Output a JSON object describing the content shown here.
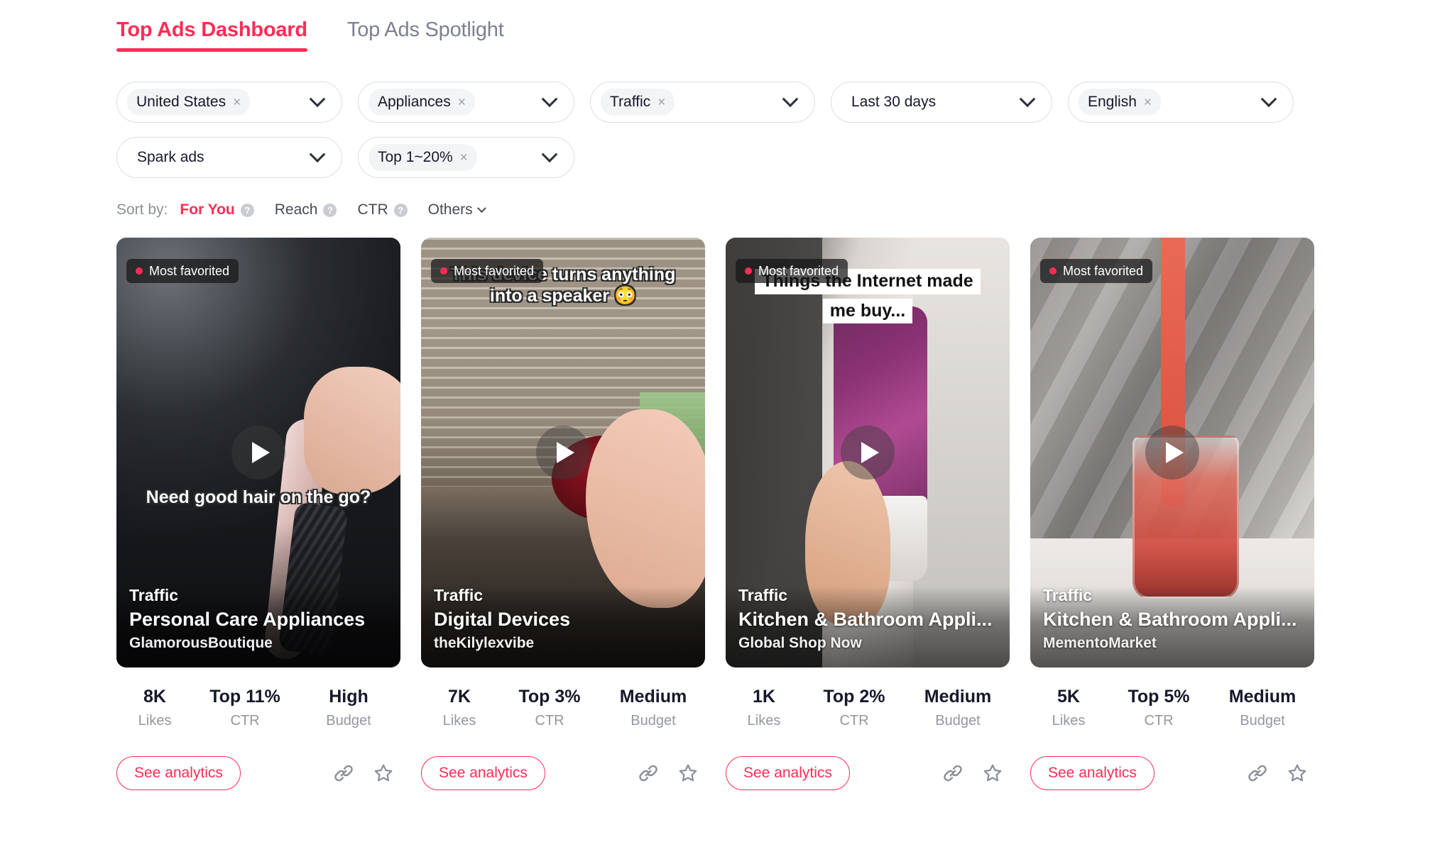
{
  "tabs": [
    {
      "label": "Top Ads Dashboard",
      "active": true
    },
    {
      "label": "Top Ads Spotlight",
      "active": false
    }
  ],
  "filters": [
    {
      "name": "region",
      "chip": "United States",
      "removable": true,
      "has_caret": true
    },
    {
      "name": "industry",
      "chip": "Appliances",
      "removable": true,
      "has_caret": true
    },
    {
      "name": "objective",
      "chip": "Traffic",
      "removable": true,
      "has_caret": true
    },
    {
      "name": "date-range",
      "plain": "Last 30 days",
      "removable": false,
      "has_caret": true
    },
    {
      "name": "language",
      "chip": "English",
      "removable": true,
      "has_caret": true
    },
    {
      "name": "ad-type",
      "plain": "Spark ads",
      "removable": false,
      "has_caret": true
    },
    {
      "name": "top-percent",
      "chip": "Top 1~20%",
      "removable": true,
      "has_caret": true
    }
  ],
  "sort": {
    "label": "Sort by:",
    "options": [
      {
        "label": "For You",
        "selected": true,
        "help": true
      },
      {
        "label": "Reach",
        "selected": false,
        "help": true
      },
      {
        "label": "CTR",
        "selected": false,
        "help": true
      },
      {
        "label": "Others",
        "selected": false,
        "help": false,
        "caret": true
      }
    ]
  },
  "labels": {
    "likes": "Likes",
    "ctr": "CTR",
    "budget": "Budget",
    "see_analytics": "See analytics",
    "badge": "Most favorited",
    "x_symbol": "×",
    "question_symbol": "?"
  },
  "colors": {
    "accent": "#fe2c55",
    "text": "#16182b",
    "muted": "#9497a1",
    "border": "#dcdfe4"
  },
  "cards": [
    {
      "badge": "Most favorited",
      "caption_lines": [
        "Need good hair on the go?"
      ],
      "caption_style": "stroke",
      "caption_pos": "middle",
      "objective": "Traffic",
      "category": "Personal Care Appliances",
      "advertiser": "GlamorousBoutique",
      "likes": "8K",
      "ctr": "Top 11%",
      "budget": "High",
      "see_analytics": "See analytics"
    },
    {
      "badge": "Most favorited",
      "caption_lines": [
        "This device turns anything",
        "into a speaker 😳"
      ],
      "caption_style": "stroke",
      "caption_pos": "top",
      "objective": "Traffic",
      "category": "Digital Devices",
      "advertiser": "theKilylexvibe",
      "likes": "7K",
      "ctr": "Top 3%",
      "budget": "Medium",
      "see_analytics": "See analytics"
    },
    {
      "badge": "Most favorited",
      "caption_lines": [
        "Things the Internet made",
        "me buy..."
      ],
      "caption_style": "box",
      "caption_pos": "top",
      "objective": "Traffic",
      "category": "Kitchen & Bathroom Appli...",
      "advertiser": "Global Shop Now",
      "likes": "1K",
      "ctr": "Top 2%",
      "budget": "Medium",
      "see_analytics": "See analytics"
    },
    {
      "badge": "Most favorited",
      "caption_lines": [],
      "caption_style": "none",
      "caption_pos": "top",
      "objective": "Traffic",
      "category": "Kitchen & Bathroom Appli...",
      "advertiser": "MementoMarket",
      "likes": "5K",
      "ctr": "Top 5%",
      "budget": "Medium",
      "see_analytics": "See analytics"
    }
  ]
}
